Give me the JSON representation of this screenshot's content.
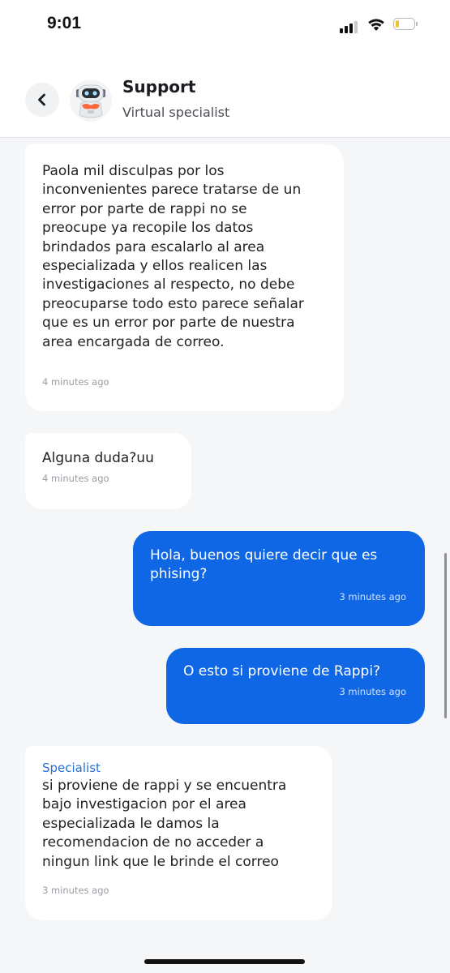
{
  "status_bar": {
    "time": "9:01",
    "battery_level": 0.2,
    "battery_color": "#f2c530"
  },
  "header": {
    "back_icon": "chevron-left-icon",
    "title": "Support",
    "subtitle": "Virtual specialist"
  },
  "messages": [
    {
      "direction": "incoming",
      "text": "Paola mil disculpas por los\ninconvenientes parece tratarse de un\nerror por parte de rappi no se\npreocupe ya recopile los datos\nbrindados para escalarlo al area\nespecializada y ellos realicen las\ninvestigaciones al respecto, no debe\npreocuparse todo esto parece señalar\nque es un error por parte de nuestra\narea encargada de correo.",
      "time": "4 minutes ago"
    },
    {
      "direction": "incoming",
      "text": "Alguna duda?uu",
      "time": "4 minutes ago"
    },
    {
      "direction": "outgoing",
      "text": "Hola, buenos quiere decir que es\nphising?",
      "time": "3 minutes ago"
    },
    {
      "direction": "outgoing",
      "text": "O esto si proviene de Rappi?",
      "time": "3 minutes ago"
    },
    {
      "direction": "incoming",
      "sender": "Specialist",
      "text": "si proviene de rappi y se encuentra\nbajo investigacion por el area\nespecializada le damos la\nrecomendacion de no acceder a\nningun link que le brinde el correo",
      "time": "3 minutes ago"
    }
  ],
  "colors": {
    "background": "#f5f6f8",
    "outgoing_bubble": "#0f67e6",
    "incoming_bubble": "#ffffff",
    "specialist_label": "#2a6fd6"
  }
}
